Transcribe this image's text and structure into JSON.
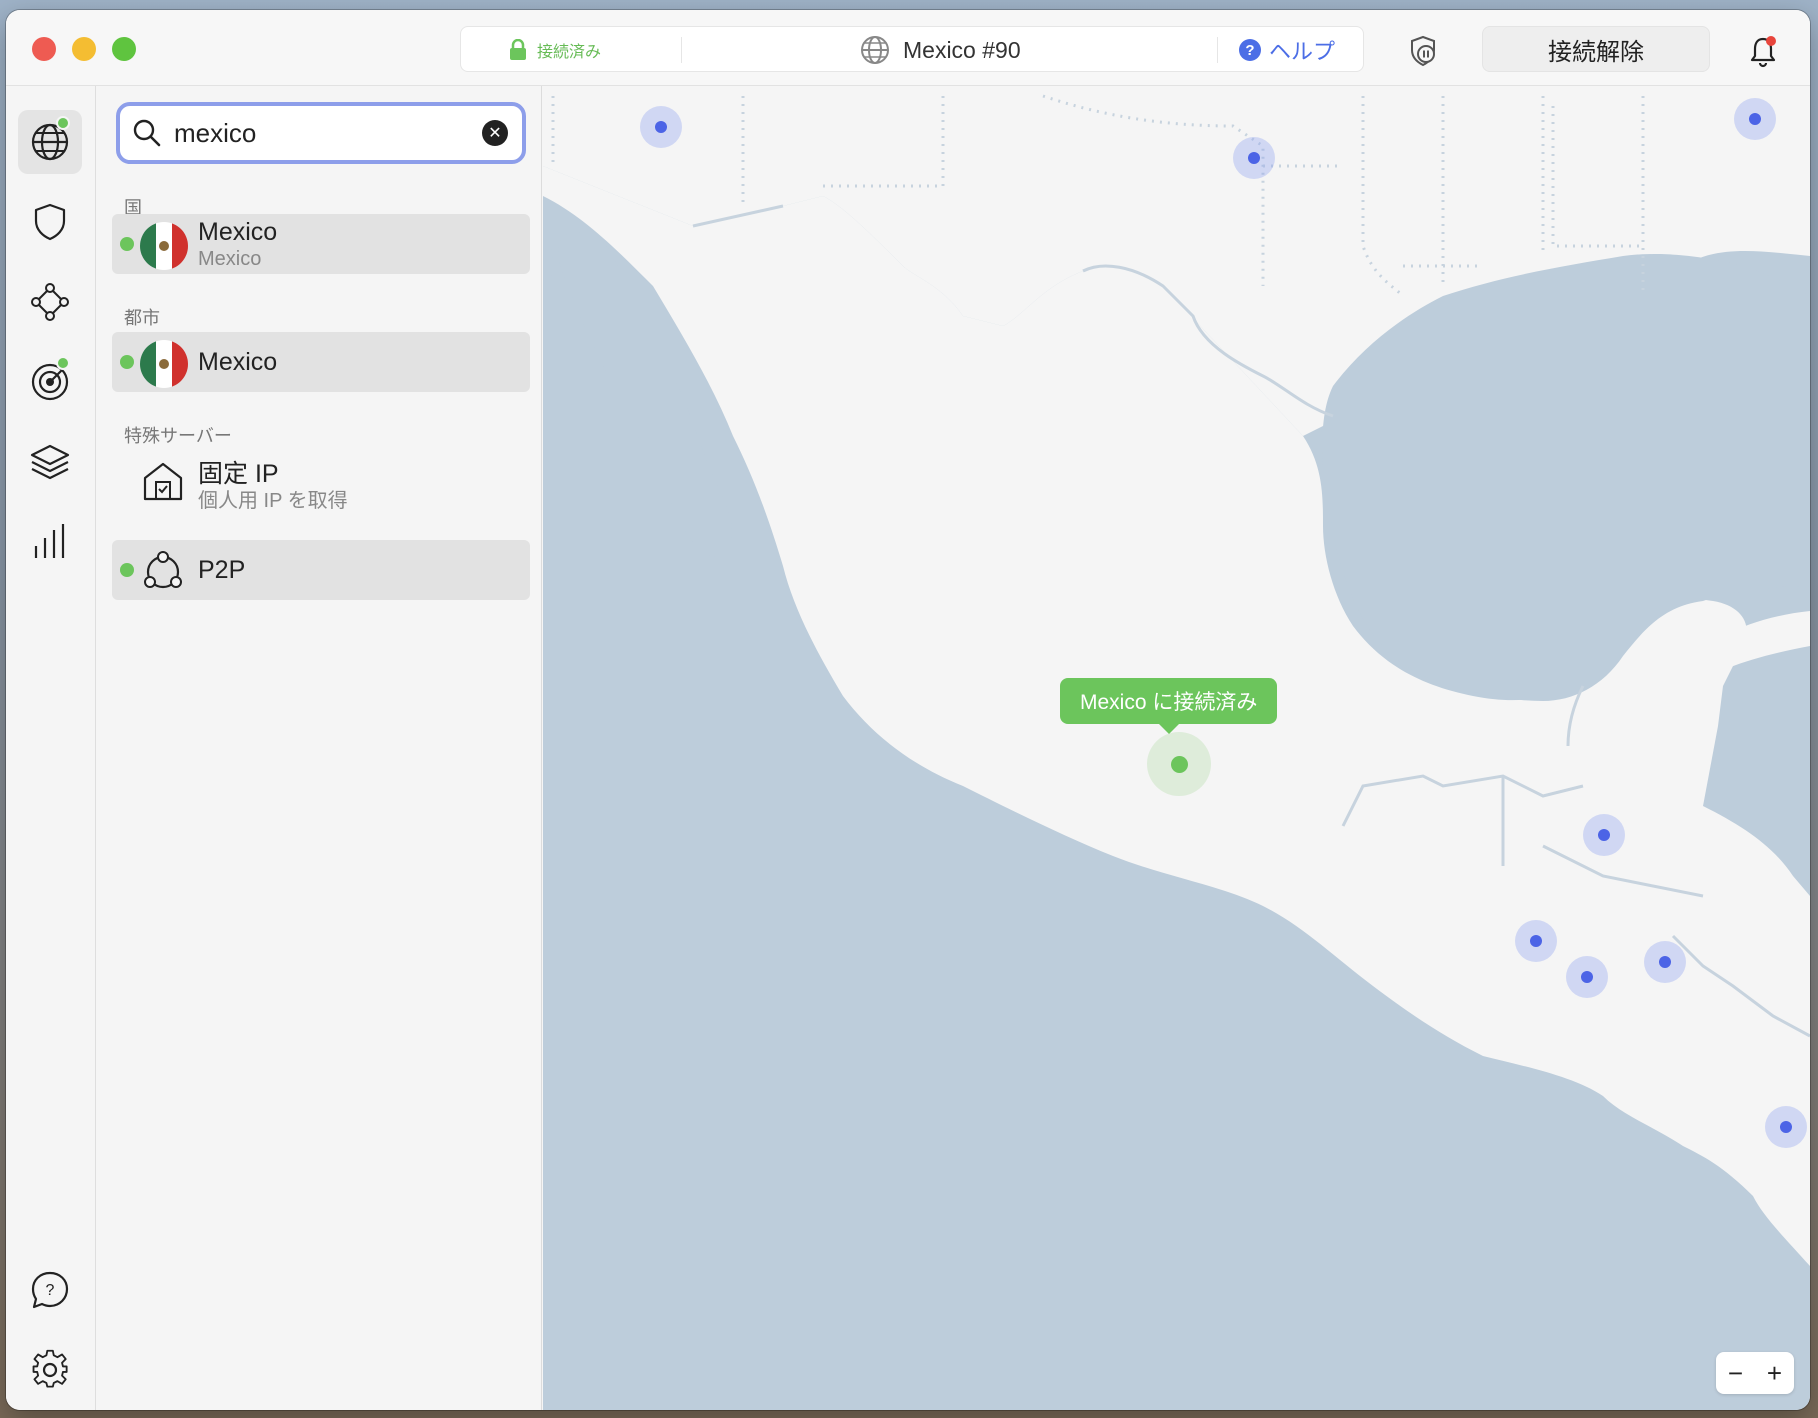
{
  "titlebar": {
    "status": "接続済み",
    "server": "Mexico #90",
    "help": "ヘルプ",
    "help_glyph": "?",
    "disconnect": "接続解除"
  },
  "search": {
    "value": "mexico",
    "placeholder": "",
    "clear_glyph": "✕"
  },
  "sections": {
    "country": "国",
    "city": "都市",
    "special": "特殊サーバー"
  },
  "country_row": {
    "title": "Mexico",
    "subtitle": "Mexico"
  },
  "city_row": {
    "title": "Mexico"
  },
  "special_rows": [
    {
      "title": "固定 IP",
      "subtitle": "個人用 IP を取得",
      "icon": "house-icon"
    },
    {
      "title": "P2P",
      "icon": "p2p-icon"
    }
  ],
  "map": {
    "tooltip": "Mexico に接続済み",
    "zoom_out": "−",
    "zoom_in": "+"
  },
  "colors": {
    "connected_green": "#6cc55c",
    "accent_blue": "#4c6ee6",
    "map_water": "#bdcddb",
    "map_land": "#f5f5f5"
  }
}
